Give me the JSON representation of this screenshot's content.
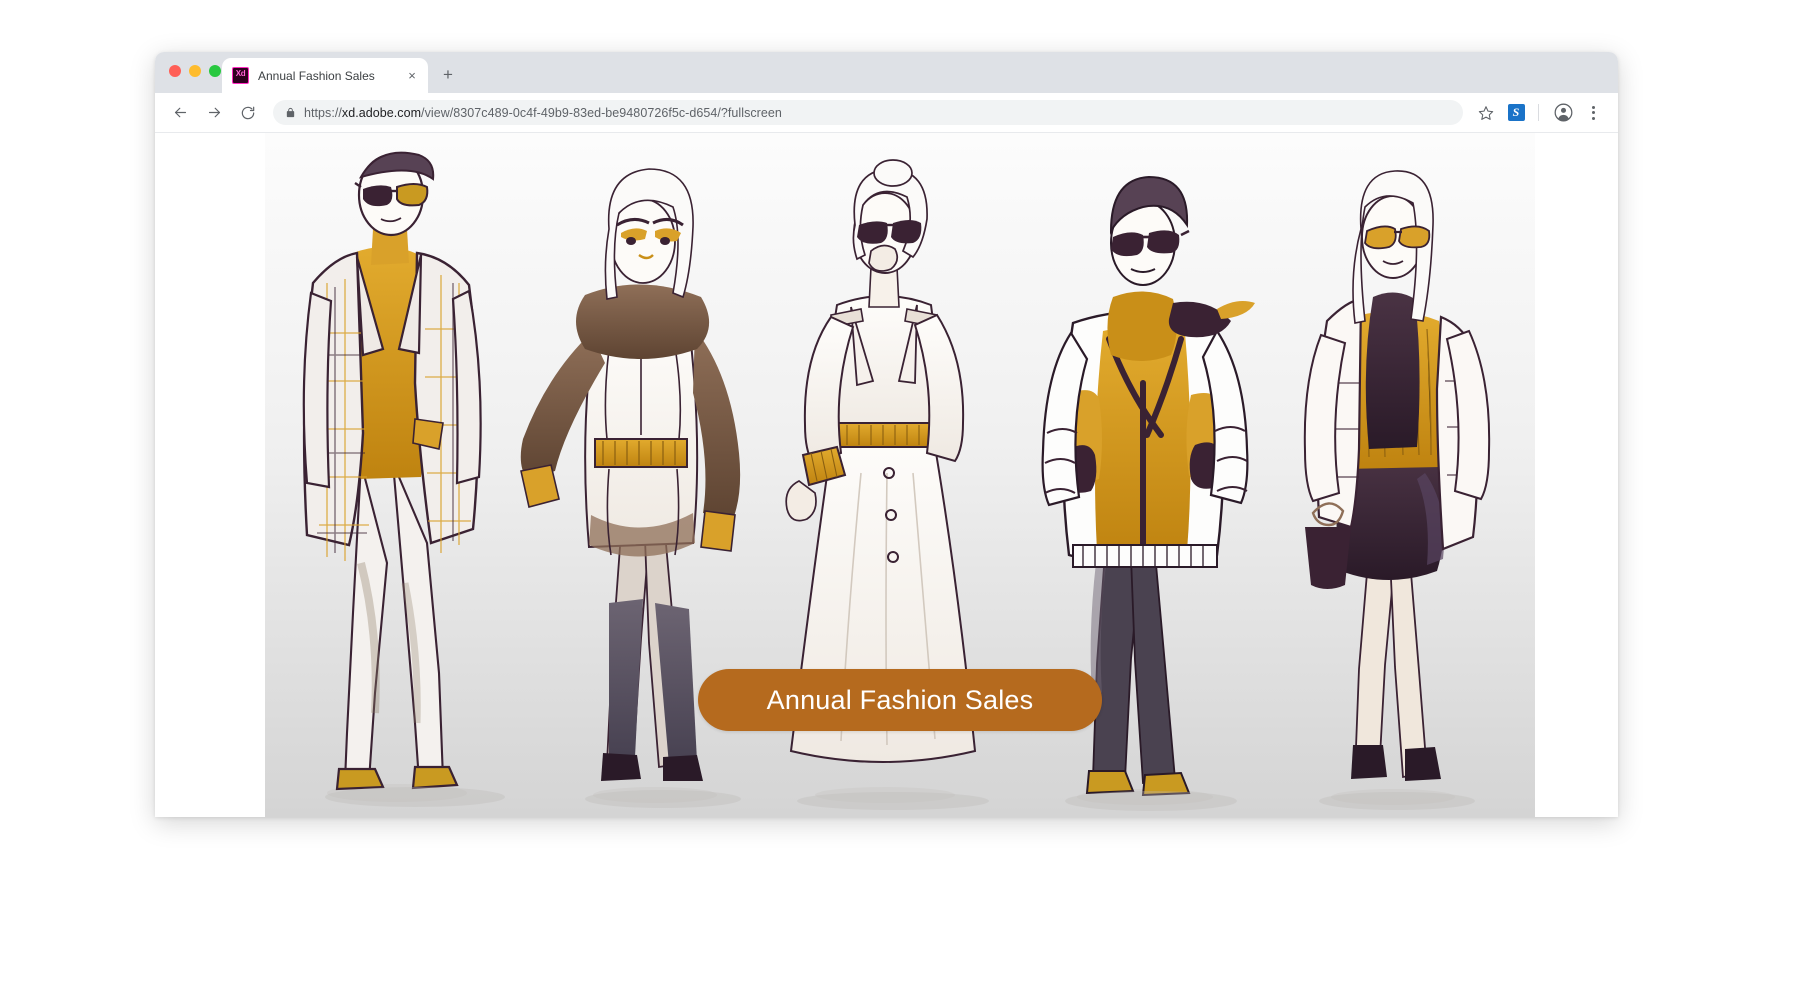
{
  "window": {
    "traffic_lights": [
      {
        "name": "close",
        "color": "#ff5f57"
      },
      {
        "name": "minimize",
        "color": "#febc2e"
      },
      {
        "name": "maximize",
        "color": "#28c840"
      }
    ]
  },
  "tab_strip": {
    "tabs": [
      {
        "favicon_label": "Xd",
        "title": "Annual Fashion Sales",
        "close_label": "×"
      }
    ],
    "new_tab_label": "+"
  },
  "toolbar": {
    "back_label": "Back",
    "forward_label": "Forward",
    "reload_label": "Reload",
    "lock_label": "Secure",
    "url_scheme": "https://",
    "url_host": "xd.adobe.com",
    "url_path": "/view/8307c489-0c4f-49b9-83ed-be9480726f5c-d654/?fullscreen",
    "url_full": "https://xd.adobe.com/view/8307c489-0c4f-49b9-83ed-be9480726f5c-d654/?fullscreen",
    "bookmark_label": "☆",
    "extension_label": "S",
    "profile_label": "Profile",
    "menu_label": "More"
  },
  "page": {
    "banner": {
      "text": "Annual Fashion Sales",
      "background_color": "#b56a1e",
      "text_color": "#ffffff"
    },
    "artwork": {
      "title": "Annual Fashion Sales",
      "medium": "watercolour-ink-fashion-illustration",
      "figure_count": 5,
      "palette": {
        "gold": "#d9a12a",
        "mustard": "#c98f18",
        "ink": "#3a2233",
        "sepia": "#7a5a46",
        "taupe": "#a98d7d",
        "background_top": "#fcfcfc",
        "background_bottom": "#d4d4d4"
      },
      "figures": [
        {
          "index": 1,
          "description": "plaid blazer with gold turtleneck and sunglasses"
        },
        {
          "index": 2,
          "description": "white hair, brown fur collar, gold belt, thigh-high boots"
        },
        {
          "index": 3,
          "description": "cream trench coat with gold belt and sunglasses"
        },
        {
          "index": 4,
          "description": "mustard bomber jacket with dark trousers and sunglasses"
        },
        {
          "index": 5,
          "description": "gold pleated top, dark skirt, handbag, sunglasses"
        }
      ]
    }
  }
}
